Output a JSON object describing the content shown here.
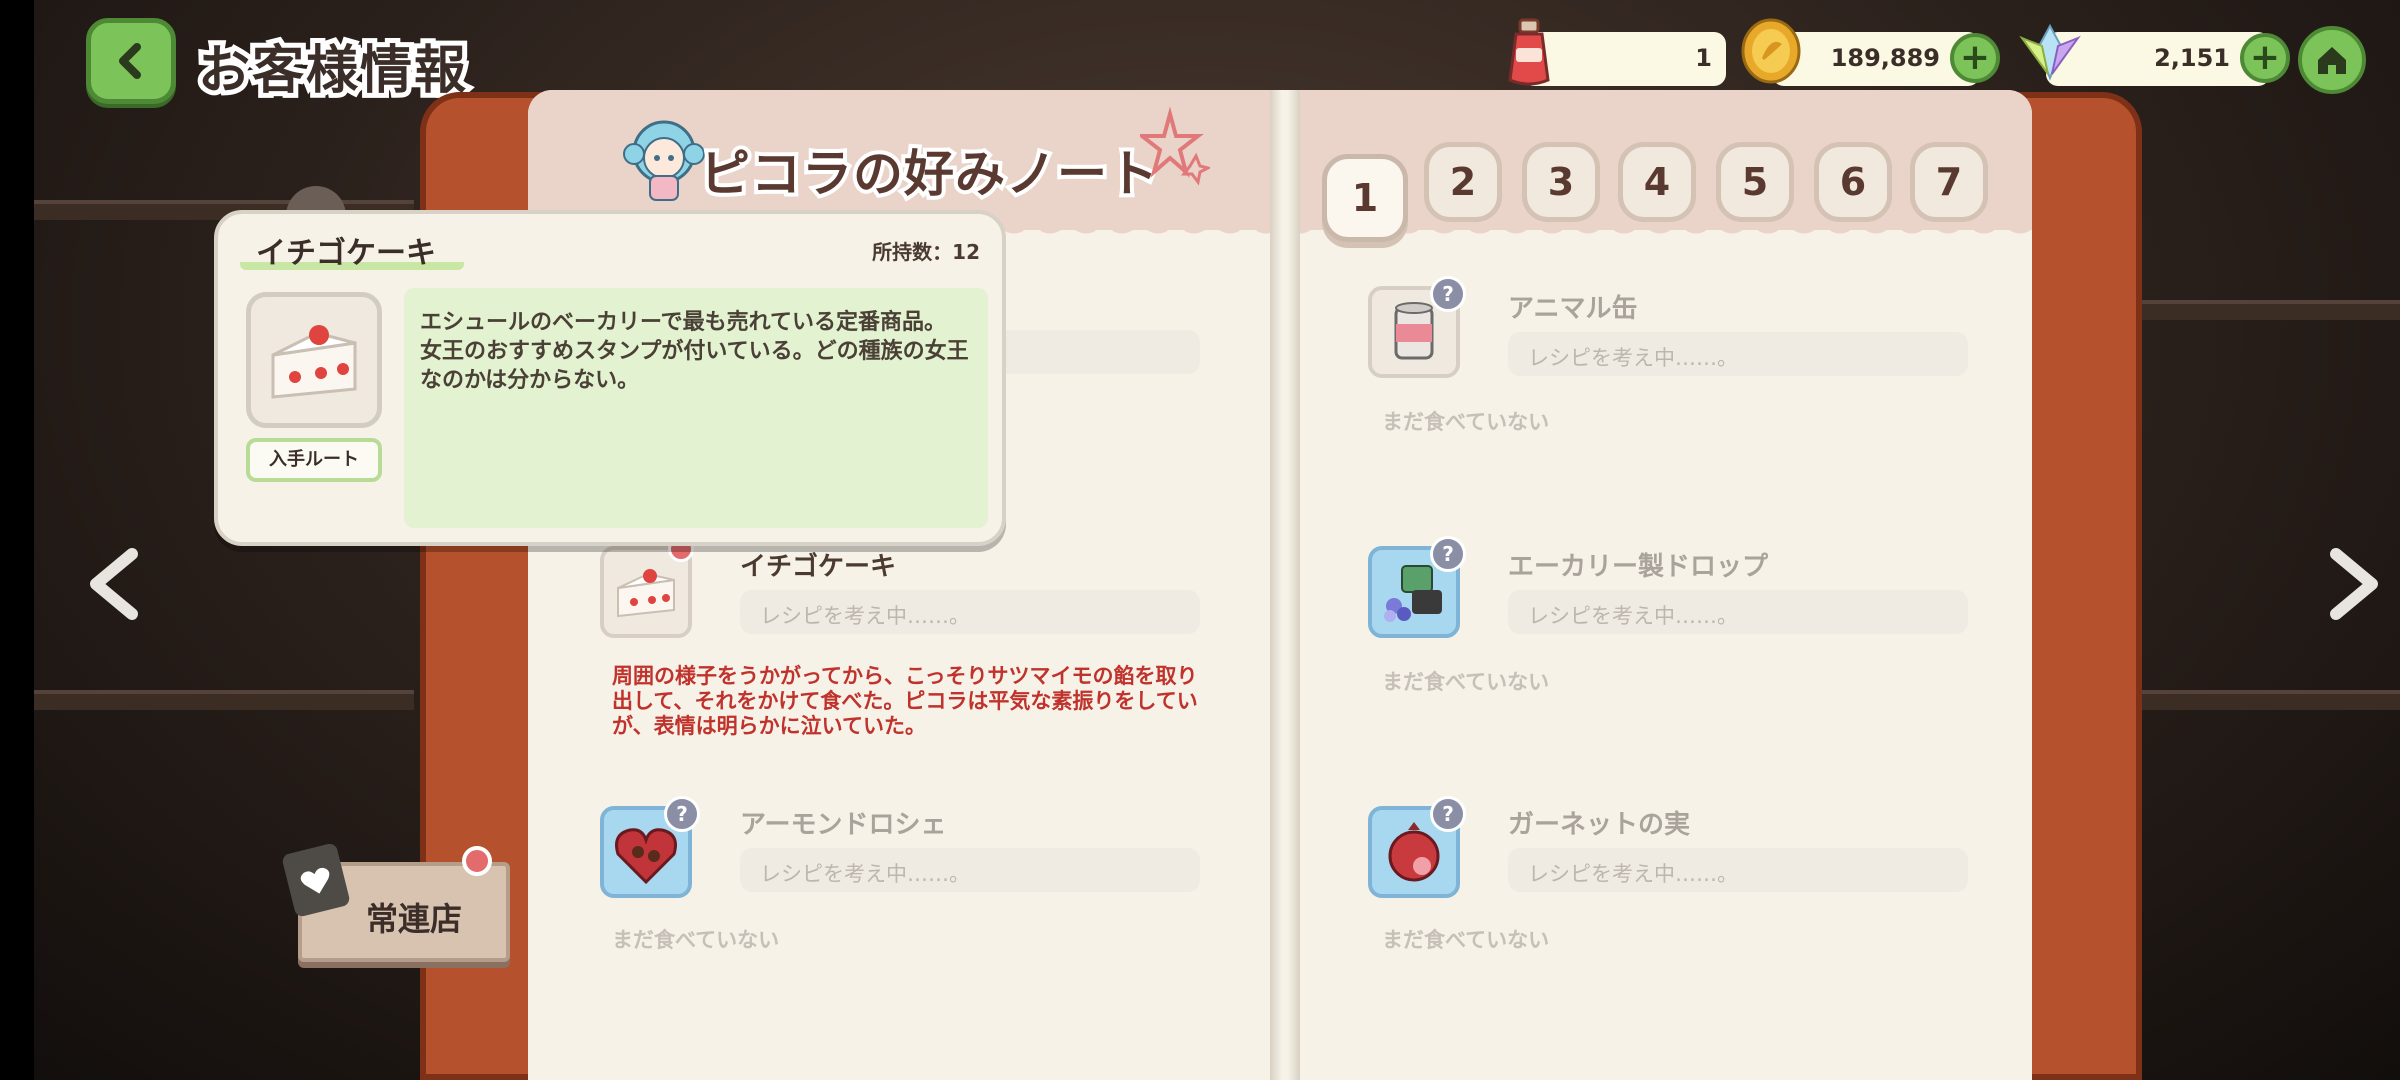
{
  "header": {
    "title": "お客様情報"
  },
  "resources": {
    "potion": {
      "value": "1",
      "icon": "red-potion-icon"
    },
    "coins": {
      "value": "189,889",
      "icon": "gold-coin-icon"
    },
    "gems": {
      "value": "2,151",
      "icon": "crystal-gem-icon"
    }
  },
  "book": {
    "title": "ピコラの好みノート",
    "tabs": [
      "1",
      "2",
      "3",
      "4",
      "5",
      "6",
      "7"
    ],
    "active_tab": "1"
  },
  "items": [
    {
      "name": "イチゴケーキ",
      "recipe": "レシピを考え中……。",
      "icon": "strawberry-cake-icon"
    },
    {
      "name": "アーモンドロシェ",
      "recipe": "レシピを考え中……。",
      "status": "まだ食べていない",
      "icon": "almond-rocher-icon"
    },
    {
      "name": "アニマル缶",
      "recipe": "レシピを考え中……。",
      "status": "まだ食べていない",
      "icon": "animal-can-icon"
    },
    {
      "name": "エーカリー製ドロップ",
      "recipe": "レシピを考え中……。",
      "status": "まだ食べていない",
      "icon": "drop-candy-icon"
    },
    {
      "name": "ガーネットの実",
      "recipe": "レシピを考え中……。",
      "status": "まだ食べていない",
      "icon": "garnet-fruit-icon"
    }
  ],
  "memo": "周囲の様子をうかがってから、こっそりサツマイモの餡を取り出して、それをかけて食べた。ピコラは平気な素振りをしていが、表情は明らかに泣いていた。",
  "tooltip": {
    "name": "イチゴケーキ",
    "count": "所持数：12",
    "route_label": "入手ルート",
    "description": "エシュールのベーカリーで最も売れている定番商品。\n女王のおすすめスタンプが付いている。どの種族の女王なのかは分からない。"
  },
  "side": {
    "regular_label": "常連店"
  },
  "unknown_badge": "?"
}
